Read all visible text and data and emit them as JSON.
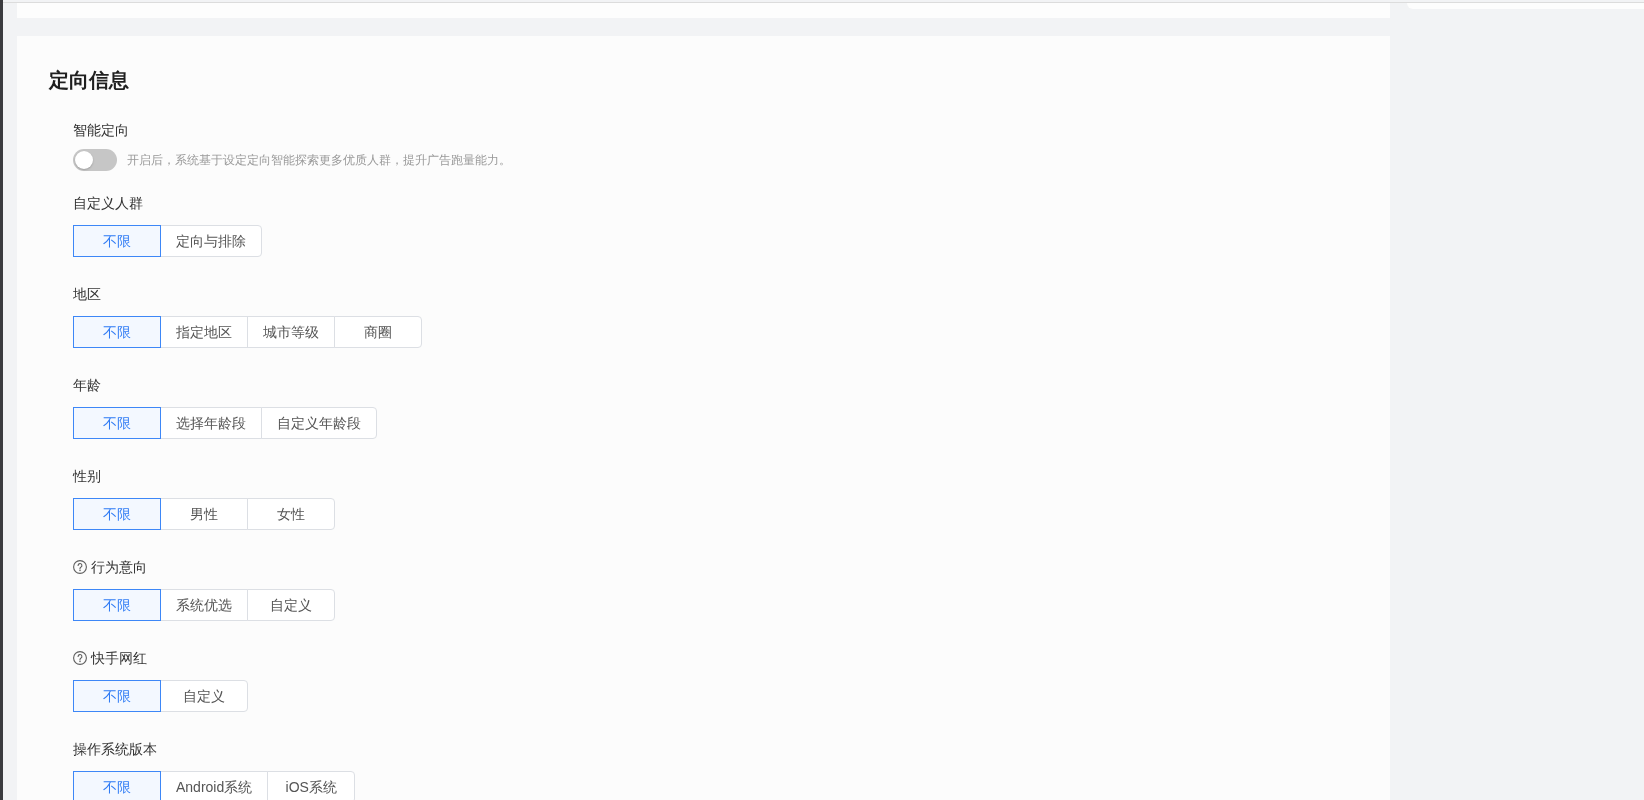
{
  "section": {
    "title": "定向信息",
    "fields": [
      {
        "kind": "switch",
        "label": "智能定向",
        "help": false,
        "on": false,
        "hint": "开启后，系统基于设定定向智能探索更多优质人群，提升广告跑量能力。"
      },
      {
        "kind": "options",
        "label": "自定义人群",
        "help": false,
        "options": [
          {
            "label": "不限",
            "selected": true
          },
          {
            "label": "定向与排除",
            "selected": false
          }
        ]
      },
      {
        "kind": "options",
        "label": "地区",
        "help": false,
        "options": [
          {
            "label": "不限",
            "selected": true
          },
          {
            "label": "指定地区",
            "selected": false
          },
          {
            "label": "城市等级",
            "selected": false
          },
          {
            "label": "商圈",
            "selected": false
          }
        ]
      },
      {
        "kind": "options",
        "label": "年龄",
        "help": false,
        "options": [
          {
            "label": "不限",
            "selected": true
          },
          {
            "label": "选择年龄段",
            "selected": false
          },
          {
            "label": "自定义年龄段",
            "selected": false
          }
        ]
      },
      {
        "kind": "options",
        "label": "性别",
        "help": false,
        "options": [
          {
            "label": "不限",
            "selected": true
          },
          {
            "label": "男性",
            "selected": false
          },
          {
            "label": "女性",
            "selected": false
          }
        ]
      },
      {
        "kind": "options",
        "label": "行为意向",
        "help": true,
        "options": [
          {
            "label": "不限",
            "selected": true
          },
          {
            "label": "系统优选",
            "selected": false
          },
          {
            "label": "自定义",
            "selected": false
          }
        ]
      },
      {
        "kind": "options",
        "label": "快手网红",
        "help": true,
        "options": [
          {
            "label": "不限",
            "selected": true
          },
          {
            "label": "自定义",
            "selected": false
          }
        ]
      },
      {
        "kind": "options",
        "label": "操作系统版本",
        "help": false,
        "options": [
          {
            "label": "不限",
            "selected": true
          },
          {
            "label": "Android系统",
            "selected": false
          },
          {
            "label": "iOS系统",
            "selected": false
          }
        ]
      }
    ]
  }
}
